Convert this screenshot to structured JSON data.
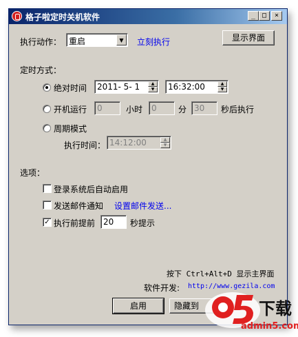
{
  "window": {
    "title": "格子啦定时关机软件",
    "controls": {
      "minimize": "_",
      "maximize": "□",
      "close": "×"
    }
  },
  "action": {
    "label": "执行动作：",
    "selected": "重启",
    "execute_now": "立刻执行",
    "show_interface": "显示界面"
  },
  "timing": {
    "label": "定时方式：",
    "absolute": {
      "label": "绝对时间",
      "checked": true,
      "date": "2011- 5- 1",
      "time": "16:32:00"
    },
    "boot": {
      "label": "开机运行",
      "checked": false,
      "hours": "0",
      "hours_unit": "小时",
      "minutes": "0",
      "minutes_unit": "分",
      "seconds": "30",
      "seconds_suffix": "秒后执行"
    },
    "periodic": {
      "label": "周期模式",
      "checked": false,
      "exec_time_label": "执行时间：",
      "exec_time": "14:12:00"
    }
  },
  "options": {
    "label": "选项：",
    "autostart": {
      "label": "登录系统后自动启用",
      "checked": false
    },
    "email": {
      "label": "发送邮件通知",
      "checked": false,
      "settings_link": "设置邮件发送..."
    },
    "remind": {
      "label": "执行前提前",
      "checked": true,
      "value": "20",
      "suffix": "秒提示"
    }
  },
  "footer": {
    "hotkey": "按下 Ctrl+Alt+D 显示主界面",
    "developer_label": "软件开发:",
    "developer_url": "http://www.gezila.com",
    "enable": "启用",
    "hide": "隐藏到"
  },
  "watermark": {
    "brand": "a5",
    "tag": "下载",
    "site": "admin5.com"
  }
}
